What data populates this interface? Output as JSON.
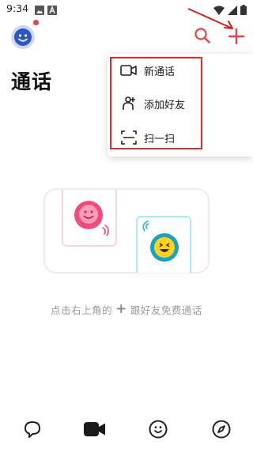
{
  "status_bar": {
    "time": "9:34",
    "icons": [
      "image-icon",
      "a-badge-icon",
      "wifi-icon",
      "signal-icon",
      "battery-icon"
    ]
  },
  "header": {
    "title": "通话",
    "avatar_icon": "smiley-avatar-icon",
    "search_icon": "search-icon",
    "add_icon": "plus-icon",
    "accent_color": "#e9434a"
  },
  "dropdown_menu": {
    "items": [
      {
        "icon": "video-camera-icon",
        "label": "新通话"
      },
      {
        "icon": "add-friend-icon",
        "label": "添加好友"
      },
      {
        "icon": "scan-icon",
        "label": "扫一扫"
      }
    ],
    "highlight_color": "#e02b2b"
  },
  "empty_state": {
    "hint_before": "点击右上角的",
    "hint_symbol": "+",
    "hint_after": "跟好友免费通话"
  },
  "tab_bar": {
    "tabs": [
      {
        "icon": "chat-bubble-icon"
      },
      {
        "icon": "video-icon",
        "active": true
      },
      {
        "icon": "smiley-icon"
      },
      {
        "icon": "compass-icon"
      }
    ]
  }
}
